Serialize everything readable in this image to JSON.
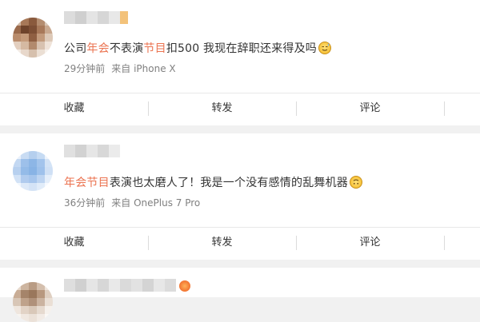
{
  "posts": [
    {
      "text_parts": [
        {
          "t": "公司",
          "hl": false
        },
        {
          "t": "年会",
          "hl": true
        },
        {
          "t": "不表演",
          "hl": false
        },
        {
          "t": "节目",
          "hl": true
        },
        {
          "t": "扣500 我现在辞职还来得及吗",
          "hl": false
        }
      ],
      "emoji": "sweat-smile-emoji-icon",
      "time": "29分钟前",
      "source": "来自 iPhone X",
      "actions": [
        "收藏",
        "转发",
        "评论"
      ]
    },
    {
      "text_parts": [
        {
          "t": "年会节目",
          "hl": true
        },
        {
          "t": "表演也太磨人了！我是一个没有感情的乱舞机器",
          "hl": false
        }
      ],
      "emoji": "upside-down-face-emoji-icon",
      "time": "36分钟前",
      "source": "来自 OnePlus 7 Pro",
      "actions": [
        "收藏",
        "转发",
        "评论"
      ]
    }
  ],
  "colors": {
    "highlight": "#eb7350",
    "meta": "#808080",
    "background": "#f1f1f1"
  }
}
